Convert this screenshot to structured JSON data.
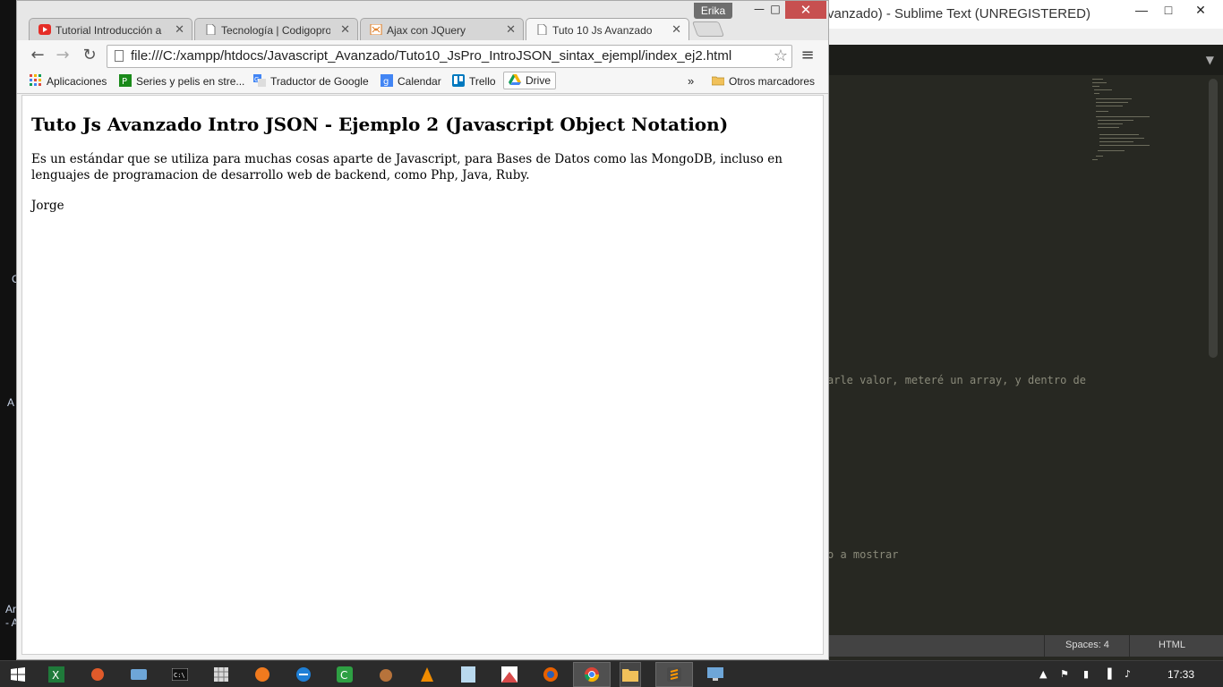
{
  "desktop": {
    "frag1": "C",
    "frag2": "A",
    "frag3": "Ar",
    "frag4": "- A"
  },
  "sublime": {
    "title": "vanzado) - Sublime Text (UNREGISTERED)",
    "code_line_1": "arle valor, meteré un array, y dentro de",
    "code_line_2": "o a mostrar",
    "status_spaces": "Spaces: 4",
    "status_syntax": "HTML"
  },
  "chrome": {
    "profile": "Erika",
    "tabs": [
      {
        "title": "Tutorial Introducción a JS",
        "icon": "youtube-icon"
      },
      {
        "title": "Tecnología | Codigoprogramacion",
        "icon": "page-icon"
      },
      {
        "title": "Ajax con JQuery",
        "icon": "orange-site-icon"
      },
      {
        "title": "Tuto 10 Js Avanzado",
        "icon": "page-icon"
      }
    ],
    "url": "file:///C:/xampp/htdocs/Javascript_Avanzado/Tuto10_JsPro_IntroJSON_sintax_ejempl/index_ej2.html",
    "bookmarks": [
      {
        "label": "Aplicaciones"
      },
      {
        "label": "Series y pelis en stre..."
      },
      {
        "label": "Traductor de Google"
      },
      {
        "label": "Calendar"
      },
      {
        "label": "Trello"
      },
      {
        "label": "Drive"
      }
    ],
    "more_chevron": "»",
    "other_bookmarks": "Otros marcadores"
  },
  "page": {
    "heading": "Tuto Js Avanzado Intro JSON - Ejemplo 2 (Javascript Object Notation)",
    "paragraph": "Es un estándar que se utiliza para muchas cosas aparte de Javascript, para Bases de Datos como las MongoDB, incluso en lenguajes de programacion de desarrollo web de backend, como Php, Java, Ruby.",
    "name": "Jorge"
  },
  "taskbar": {
    "clock": "17:33"
  },
  "colors": {
    "chrome_close": "#c75050",
    "sublime_bg": "#272822",
    "taskbar_bg": "#2b2b2b"
  }
}
